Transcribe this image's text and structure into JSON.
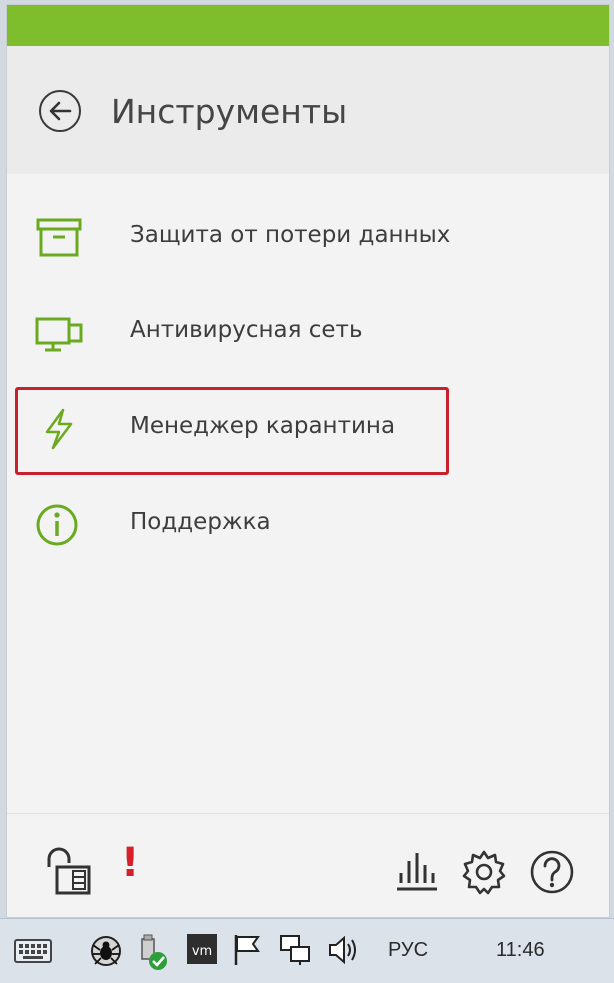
{
  "header": {
    "title": "Инструменты",
    "back_icon": "arrow-left-icon"
  },
  "menu": {
    "items": [
      {
        "label": "Защита от потери данных",
        "icon": "archive-box-icon"
      },
      {
        "label": "Антивирусная сеть",
        "icon": "monitors-network-icon"
      },
      {
        "label": "Менеджер карантина",
        "icon": "lightning-icon",
        "highlighted": true
      },
      {
        "label": "Поддержка",
        "icon": "info-icon"
      }
    ]
  },
  "footer": {
    "alert_text": "!",
    "icons": [
      "padlock-open-icon",
      "stats-bars-icon",
      "gear-icon",
      "help-icon"
    ]
  },
  "taskbar": {
    "language": "РУС",
    "time": "11:46",
    "icons": [
      "keyboard-icon",
      "spider-icon",
      "usb-check-icon",
      "vm-icon",
      "flag-icon",
      "network-icon",
      "volume-icon"
    ]
  },
  "colors": {
    "accent": "#7ebd2c",
    "highlight_border": "#c8202d",
    "icon_green": "#6aaa1f"
  }
}
